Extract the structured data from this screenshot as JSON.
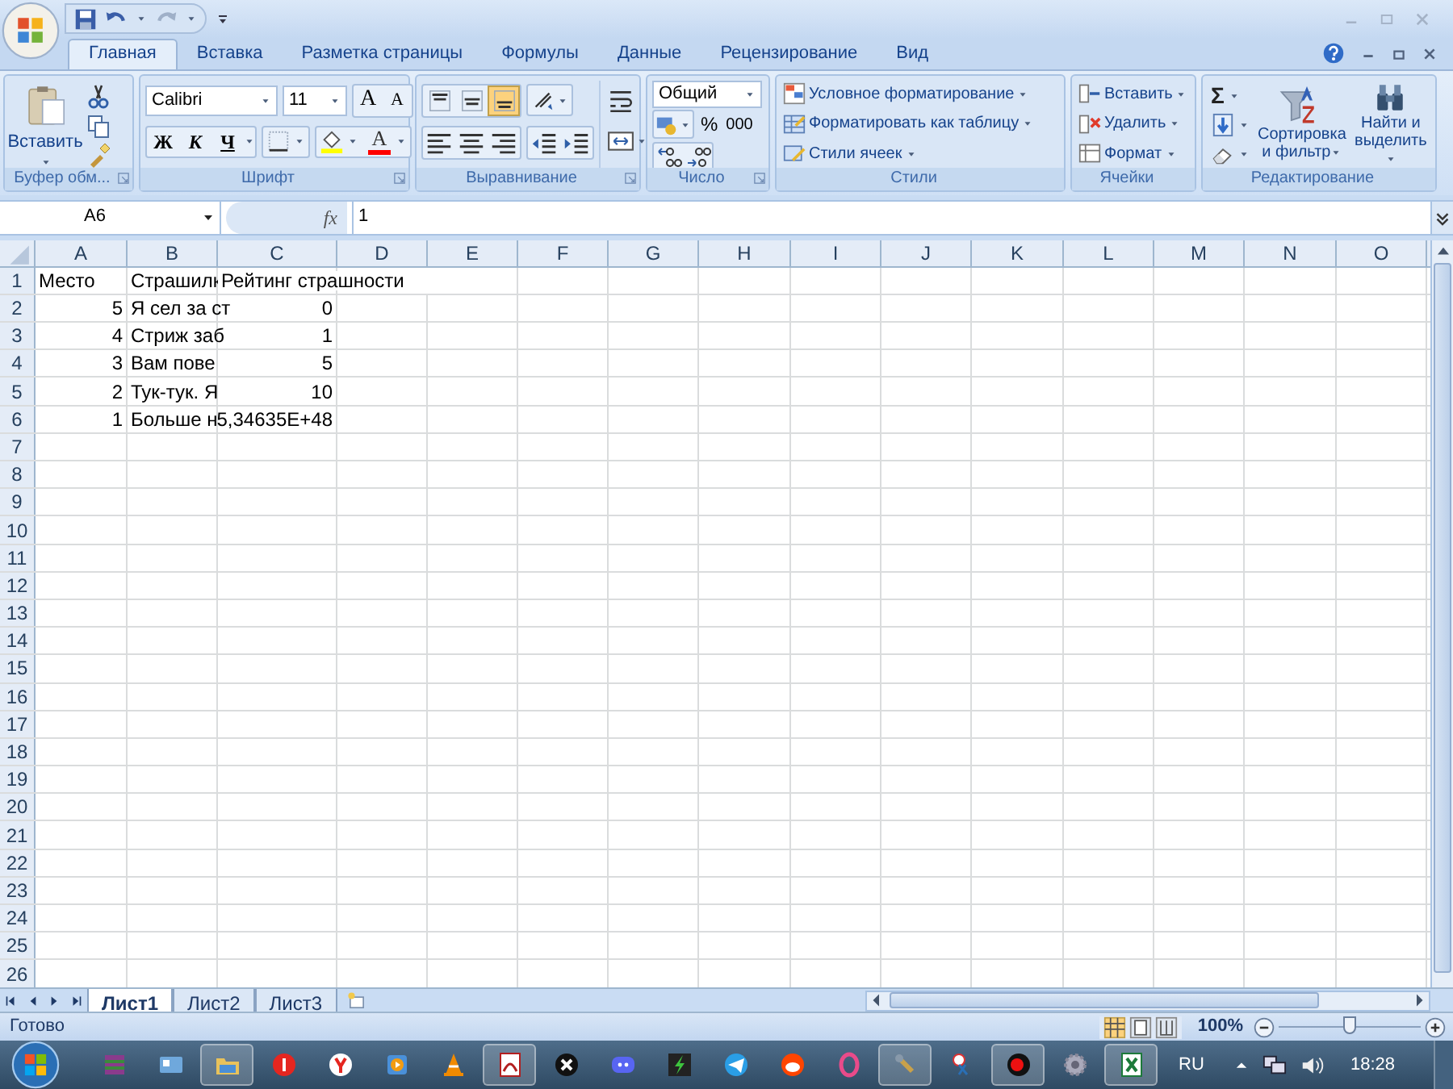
{
  "ribbon_tabs": [
    {
      "label": "Главная",
      "selected": true
    },
    {
      "label": "Вставка",
      "selected": false
    },
    {
      "label": "Разметка страницы",
      "selected": false
    },
    {
      "label": "Формулы",
      "selected": false
    },
    {
      "label": "Данные",
      "selected": false
    },
    {
      "label": "Рецензирование",
      "selected": false
    },
    {
      "label": "Вид",
      "selected": false
    }
  ],
  "clipboard": {
    "paste": "Вставить",
    "label": "Буфер обм..."
  },
  "font": {
    "name": "Calibri",
    "size": "11",
    "grow": "A",
    "shrink": "A",
    "bold": "Ж",
    "italic": "К",
    "underline": "Ч",
    "color_letter": "A",
    "label": "Шрифт"
  },
  "alignment": {
    "vertical": [
      {
        "kind": "top",
        "selected": false
      },
      {
        "kind": "middle",
        "selected": false
      },
      {
        "kind": "bottom",
        "selected": true
      }
    ],
    "label": "Выравнивание"
  },
  "number": {
    "format": "Общий",
    "percent": "%",
    "thousands": "000",
    "label": "Число"
  },
  "styles": {
    "items": [
      "Условное форматирование",
      "Форматировать как таблицу",
      "Стили ячеек"
    ],
    "label": "Стили"
  },
  "cells": {
    "items": [
      "Вставить",
      "Удалить",
      "Формат"
    ],
    "label": "Ячейки"
  },
  "editing": {
    "sum": "Σ",
    "sort": "Сортировка и фильтр",
    "find": "Найти и выделить",
    "label": "Редактирование"
  },
  "formula_bar": {
    "name_box": "A6",
    "fx": "fx",
    "value": "1"
  },
  "sheet": {
    "columns": [
      "A",
      "B",
      "C",
      "D",
      "E",
      "F",
      "G",
      "H",
      "I",
      "J",
      "K",
      "L",
      "M",
      "N",
      "O"
    ],
    "rows": [
      {
        "number": "1",
        "cells": [
          {
            "text": "Место",
            "kind": "text"
          },
          {
            "text": "Страшилк",
            "kind": "text"
          },
          {
            "text": "Рейтинг страшности",
            "kind": "text"
          }
        ]
      },
      {
        "number": "2",
        "cells": [
          {
            "text": "5",
            "kind": "number"
          },
          {
            "text": "Я сел за ст",
            "kind": "text"
          },
          {
            "text": "0",
            "kind": "number"
          }
        ]
      },
      {
        "number": "3",
        "cells": [
          {
            "text": "4",
            "kind": "number"
          },
          {
            "text": "Стриж заб",
            "kind": "text"
          },
          {
            "text": "1",
            "kind": "number"
          }
        ]
      },
      {
        "number": "4",
        "cells": [
          {
            "text": "3",
            "kind": "number"
          },
          {
            "text": "Вам пове",
            "kind": "text"
          },
          {
            "text": "5",
            "kind": "number"
          }
        ]
      },
      {
        "number": "5",
        "cells": [
          {
            "text": "2",
            "kind": "number"
          },
          {
            "text": "Тук-тук. Я",
            "kind": "text"
          },
          {
            "text": "10",
            "kind": "number"
          }
        ]
      },
      {
        "number": "6",
        "cells": [
          {
            "text": "1",
            "kind": "number"
          },
          {
            "text": "Больше н",
            "kind": "text"
          },
          {
            "text": "5,34635E+48",
            "kind": "number"
          }
        ]
      },
      {
        "number": "7"
      },
      {
        "number": "8"
      },
      {
        "number": "9"
      },
      {
        "number": "10"
      },
      {
        "number": "11"
      },
      {
        "number": "12"
      },
      {
        "number": "13"
      },
      {
        "number": "14"
      },
      {
        "number": "15"
      },
      {
        "number": "16"
      },
      {
        "number": "17"
      },
      {
        "number": "18"
      },
      {
        "number": "19"
      },
      {
        "number": "20"
      },
      {
        "number": "21"
      },
      {
        "number": "22"
      },
      {
        "number": "23"
      },
      {
        "number": "24"
      },
      {
        "number": "25"
      },
      {
        "number": "26"
      }
    ]
  },
  "sheet_tabs": [
    {
      "label": "Лист1",
      "selected": true
    },
    {
      "label": "Лист2",
      "selected": false
    },
    {
      "label": "Лист3",
      "selected": false
    }
  ],
  "status_bar": {
    "text": "Готово",
    "zoom": "100%",
    "zoom_slider": {
      "level": 0.5
    }
  },
  "taskbar": {
    "apps": [
      {
        "kind": "archive",
        "open": false
      },
      {
        "kind": "panel",
        "open": false
      },
      {
        "kind": "folder",
        "open": true
      },
      {
        "kind": "yandex",
        "open": false
      },
      {
        "kind": "browser",
        "open": false
      },
      {
        "kind": "player",
        "open": false
      },
      {
        "kind": "cone",
        "open": false
      },
      {
        "kind": "acrobat",
        "open": true
      },
      {
        "kind": "cross",
        "open": false
      },
      {
        "kind": "chat",
        "open": false
      },
      {
        "kind": "bolt",
        "open": false
      },
      {
        "kind": "telegram",
        "open": false
      },
      {
        "kind": "reddit",
        "open": false
      },
      {
        "kind": "ring",
        "open": false
      },
      {
        "kind": "wrench",
        "open": true
      },
      {
        "kind": "scissors",
        "open": false
      },
      {
        "kind": "ball",
        "open": true
      },
      {
        "kind": "gear",
        "open": false
      },
      {
        "kind": "excel",
        "open": true
      }
    ],
    "language": "RU",
    "time": "18:28"
  }
}
